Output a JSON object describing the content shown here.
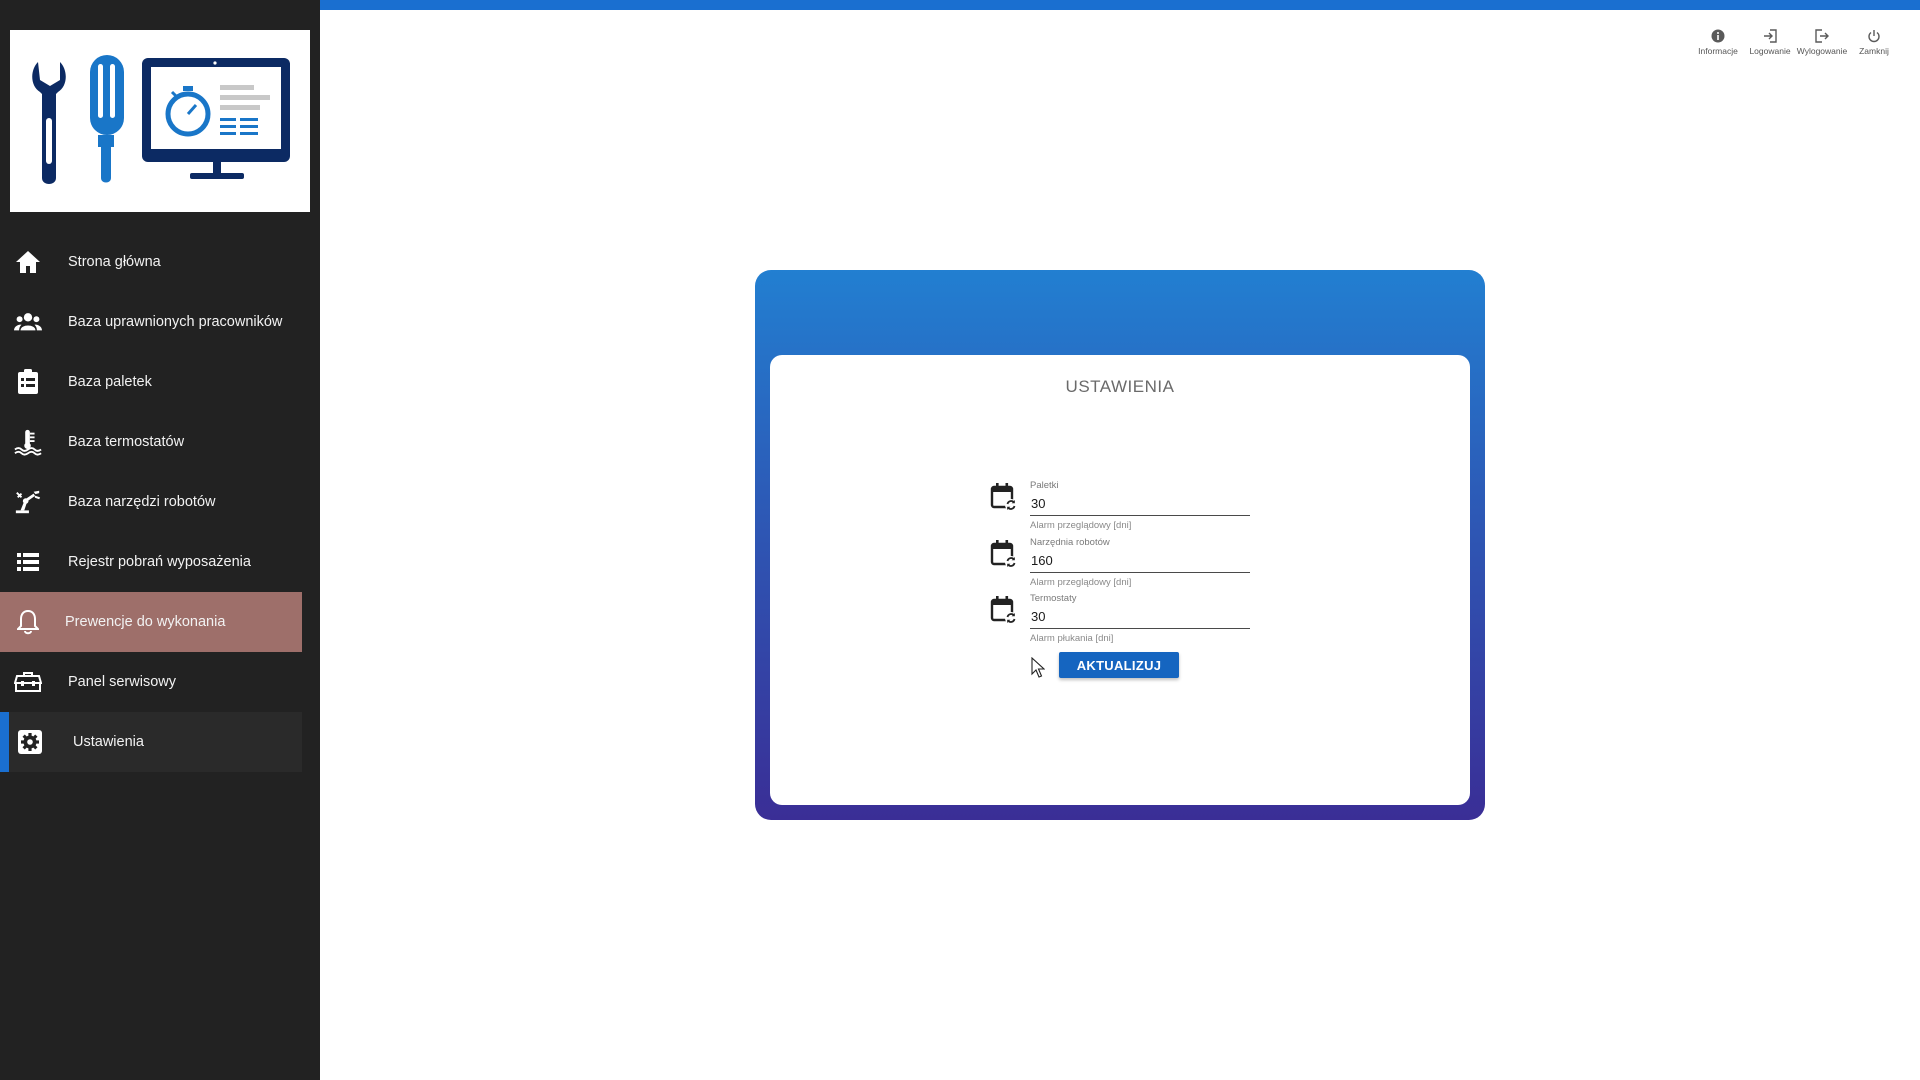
{
  "sidebar": {
    "items": [
      {
        "label": "Strona główna",
        "icon": "home-icon"
      },
      {
        "label": "Baza uprawnionych pracowników",
        "icon": "people-icon"
      },
      {
        "label": "Baza paletek",
        "icon": "clipboard-list-icon"
      },
      {
        "label": "Baza termostatów",
        "icon": "thermostat-icon"
      },
      {
        "label": "Baza narzędzi robotów",
        "icon": "robot-arm-icon"
      },
      {
        "label": "Rejestr pobrań wyposażenia",
        "icon": "list-icon"
      },
      {
        "label": "Prewencje do wykonania",
        "icon": "bell-icon"
      },
      {
        "label": "Panel serwisowy",
        "icon": "toolbox-icon"
      },
      {
        "label": "Ustawienia",
        "icon": "gear-icon"
      }
    ],
    "active_item": "Ustawienia",
    "highlighted_item": "Prewencje do wykonania"
  },
  "topbar": {
    "actions": [
      {
        "label": "Informacje",
        "icon": "info-icon"
      },
      {
        "label": "Logowanie",
        "icon": "login-icon"
      },
      {
        "label": "Wylogowanie",
        "icon": "logout-icon"
      },
      {
        "label": "Zamknij",
        "icon": "power-icon"
      }
    ]
  },
  "settings": {
    "title": "USTAWIENIA",
    "fields": [
      {
        "label": "Paletki",
        "value": "30",
        "helper": "Alarm przeglądowy [dni]",
        "icon": "calendar-sync-icon"
      },
      {
        "label": "Narzędnia robotów",
        "value": "160",
        "helper": "Alarm przeglądowy [dni]",
        "icon": "calendar-sync-icon"
      },
      {
        "label": "Termostaty",
        "value": "30",
        "helper": "Alarm płukania [dni]",
        "icon": "calendar-sync-icon"
      }
    ],
    "update_label": "AKTUALIZUJ"
  },
  "colors": {
    "sidebar_bg": "#222222",
    "accent": "#1a6fd0",
    "highlight": "#9e6f6a",
    "button": "#1565c0",
    "card_gradient_top": "#227fd1",
    "card_gradient_bottom": "#3a2e96"
  }
}
